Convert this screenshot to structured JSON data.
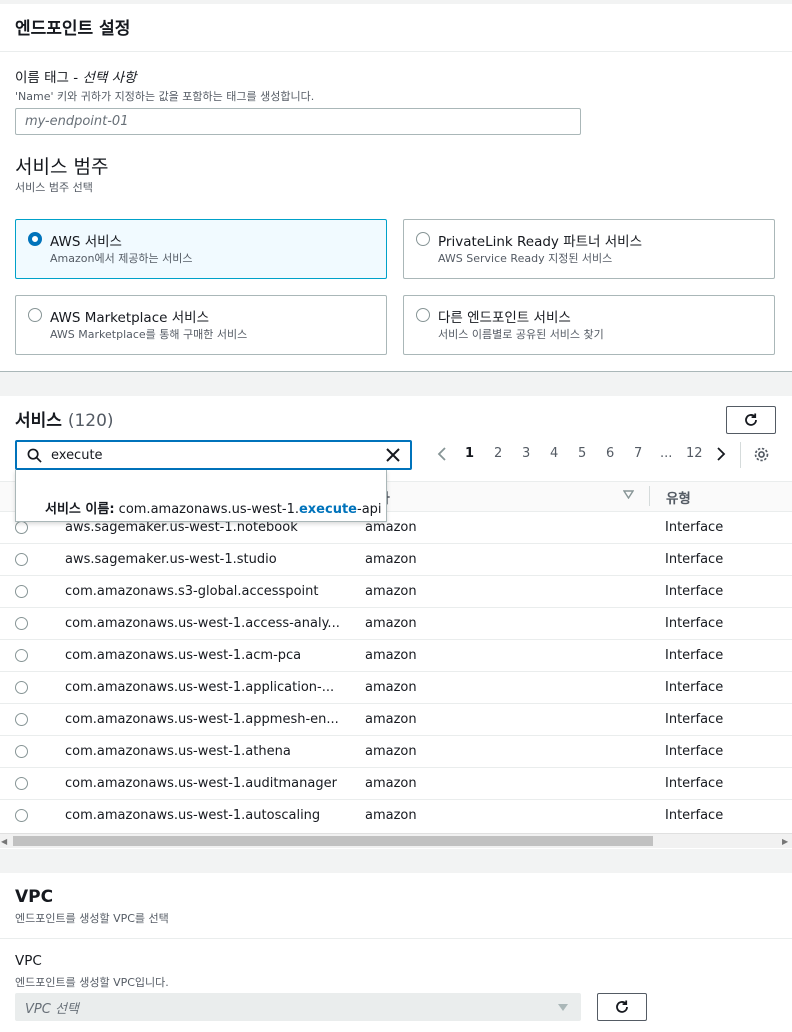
{
  "endpoint_settings": {
    "title": "엔드포인트 설정",
    "name_tag_label": "이름 태그 - ",
    "name_tag_optional": "선택 사항",
    "name_tag_desc": "'Name' 키와 귀하가 지정하는 값을 포함하는 태그를 생성합니다.",
    "name_tag_placeholder": "my-endpoint-01",
    "category_title": "서비스 범주",
    "category_desc": "서비스 범주 선택",
    "tiles": [
      {
        "title": "AWS 서비스",
        "desc": "Amazon에서 제공하는 서비스",
        "selected": true
      },
      {
        "title": "PrivateLink Ready 파트너 서비스",
        "desc": "AWS Service Ready 지정된 서비스",
        "selected": false
      },
      {
        "title": "AWS Marketplace 서비스",
        "desc": "AWS Marketplace를 통해 구매한 서비스",
        "selected": false
      },
      {
        "title": "다른 엔드포인트 서비스",
        "desc": "서비스 이름별로 공유된 서비스 찾기",
        "selected": false
      }
    ]
  },
  "services": {
    "title": "서비스",
    "count": "(120)",
    "search_value": "execute",
    "suggestion_label": "서비스 이름:",
    "suggestion_prefix": "com.amazonaws.us-west-1.",
    "suggestion_match": "execute",
    "suggestion_suffix": "-api",
    "pages": [
      "1",
      "2",
      "3",
      "4",
      "5",
      "6",
      "7",
      "...",
      "12"
    ],
    "columns": {
      "owner": "소유자",
      "type": "유형"
    },
    "owner_header_visible": "유자",
    "rows": [
      {
        "name": "aws.sagemaker.us-west-1.notebook",
        "owner": "amazon",
        "type": "Interface"
      },
      {
        "name": "aws.sagemaker.us-west-1.studio",
        "owner": "amazon",
        "type": "Interface"
      },
      {
        "name": "com.amazonaws.s3-global.accesspoint",
        "owner": "amazon",
        "type": "Interface"
      },
      {
        "name": "com.amazonaws.us-west-1.access-analy...",
        "owner": "amazon",
        "type": "Interface"
      },
      {
        "name": "com.amazonaws.us-west-1.acm-pca",
        "owner": "amazon",
        "type": "Interface"
      },
      {
        "name": "com.amazonaws.us-west-1.application-...",
        "owner": "amazon",
        "type": "Interface"
      },
      {
        "name": "com.amazonaws.us-west-1.appmesh-en...",
        "owner": "amazon",
        "type": "Interface"
      },
      {
        "name": "com.amazonaws.us-west-1.athena",
        "owner": "amazon",
        "type": "Interface"
      },
      {
        "name": "com.amazonaws.us-west-1.auditmanager",
        "owner": "amazon",
        "type": "Interface"
      },
      {
        "name": "com.amazonaws.us-west-1.autoscaling",
        "owner": "amazon",
        "type": "Interface"
      }
    ]
  },
  "vpc": {
    "title": "VPC",
    "desc": "엔드포인트를 생성할 VPC를 선택",
    "field_label": "VPC",
    "field_desc": "엔드포인트를 생성할 VPC입니다.",
    "select_placeholder": "VPC 선택"
  }
}
